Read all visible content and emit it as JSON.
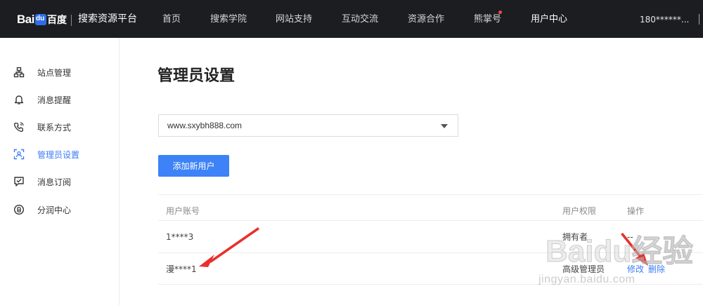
{
  "brand": {
    "logo_text": "Bai",
    "logo_cn": "百度",
    "platform": "搜索资源平台"
  },
  "nav": {
    "items": [
      {
        "label": "首页"
      },
      {
        "label": "搜索学院"
      },
      {
        "label": "网站支持"
      },
      {
        "label": "互动交流"
      },
      {
        "label": "资源合作"
      },
      {
        "label": "熊掌号"
      },
      {
        "label": "用户中心"
      }
    ],
    "active": "用户中心",
    "account": "180******..."
  },
  "sidebar": {
    "items": [
      {
        "label": "站点管理",
        "icon": "sitemap-icon"
      },
      {
        "label": "消息提醒",
        "icon": "bell-icon"
      },
      {
        "label": "联系方式",
        "icon": "phone-icon"
      },
      {
        "label": "管理员设置",
        "icon": "admin-icon"
      },
      {
        "label": "消息订阅",
        "icon": "subscribe-icon"
      },
      {
        "label": "分润中心",
        "icon": "revenue-icon"
      }
    ],
    "active": "管理员设置"
  },
  "main": {
    "title": "管理员设置",
    "site_select": {
      "value": "www.sxybh888.com"
    },
    "add_button": "添加新用户",
    "table": {
      "headers": [
        "用户账号",
        "用户权限",
        "操作"
      ],
      "rows": [
        {
          "account": "1****3",
          "role": "拥有者",
          "actions": "--"
        },
        {
          "account": "漫****1",
          "role": "高级管理员",
          "edit": "修改",
          "delete": "删除"
        }
      ]
    }
  },
  "watermark": {
    "main": "Baidu经验",
    "sub": "jingyan.baidu.com"
  },
  "colors": {
    "topbar": "#1c1d21",
    "accent": "#3d82f6",
    "arrow": "#e8302c"
  }
}
